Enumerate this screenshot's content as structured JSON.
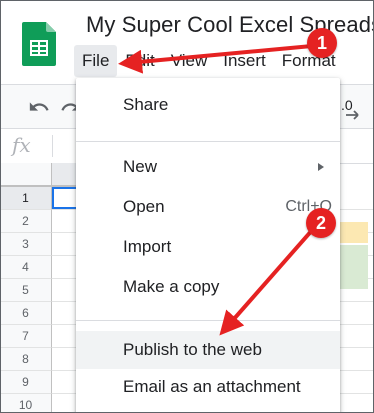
{
  "document": {
    "title": "My Super Cool Excel Spreadsheet"
  },
  "menu_bar": {
    "items": [
      {
        "label": "File",
        "active": true
      },
      {
        "label": "Edit"
      },
      {
        "label": "View"
      },
      {
        "label": "Insert"
      },
      {
        "label": "Format"
      }
    ]
  },
  "toolbar": {
    "undo_icon": "undo-icon",
    "redo_icon": "redo-icon",
    "decimal_label": ".0",
    "more_formats_icon": "decrease-decimal-icon"
  },
  "formula_bar": {
    "fx_label": "fx",
    "value": ""
  },
  "grid": {
    "selected_cell": "A1",
    "row_numbers": [
      "1",
      "2",
      "3",
      "4",
      "5",
      "6",
      "7",
      "8",
      "9",
      "10"
    ],
    "fill_colors": {
      "yellow": "#fce8b2",
      "green": "#d9ead3",
      "selection": "#1a73e8"
    }
  },
  "file_menu": {
    "items": [
      {
        "label": "Share"
      },
      {
        "label": "New",
        "submenu": true
      },
      {
        "label": "Open",
        "shortcut": "Ctrl+O"
      },
      {
        "label": "Import"
      },
      {
        "label": "Make a copy"
      },
      {
        "label": "Publish to the web",
        "highlighted": true
      },
      {
        "label": "Email as an attachment"
      }
    ]
  },
  "annotations": {
    "badges": [
      "1",
      "2"
    ],
    "color": "#e52222"
  }
}
